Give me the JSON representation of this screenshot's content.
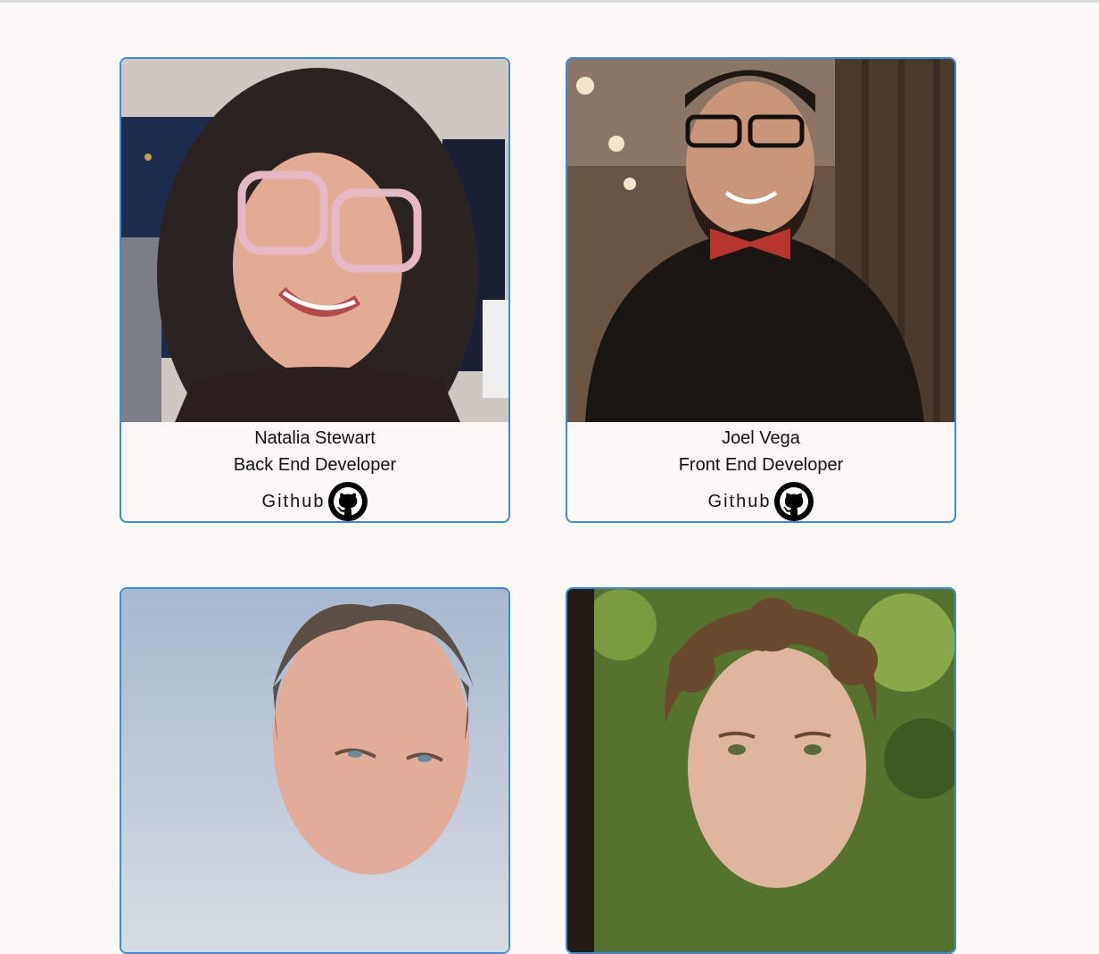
{
  "members": [
    {
      "name": "Natalia Stewart",
      "role": "Back End Developer",
      "link_label": "Github",
      "icon": "github-icon",
      "photo_palette": {
        "bg": "#c9c2bc",
        "monitor": "#1c2a4a",
        "hair": "#2a2220",
        "skin": "#e2ab93",
        "shirt": "#2a1f1c"
      }
    },
    {
      "name": "Joel Vega",
      "role": "Front End Developer",
      "link_label": "Github",
      "icon": "github-icon",
      "photo_palette": {
        "bg": "#6e5646",
        "hair": "#1e1814",
        "skin": "#c9967a",
        "shirt": "#1a1614",
        "bowtie": "#b8342e"
      }
    },
    {
      "photo_palette": {
        "bg": "#b9c6d8",
        "hair": "#5b5045",
        "skin": "#e1ad98"
      }
    },
    {
      "photo_palette": {
        "bg": "#4d6a2c",
        "hair": "#6a4a2e",
        "skin": "#e0b59d"
      }
    }
  ],
  "colors": {
    "card_border": "#3f8ad8",
    "page_bg": "#fdf8f8"
  }
}
